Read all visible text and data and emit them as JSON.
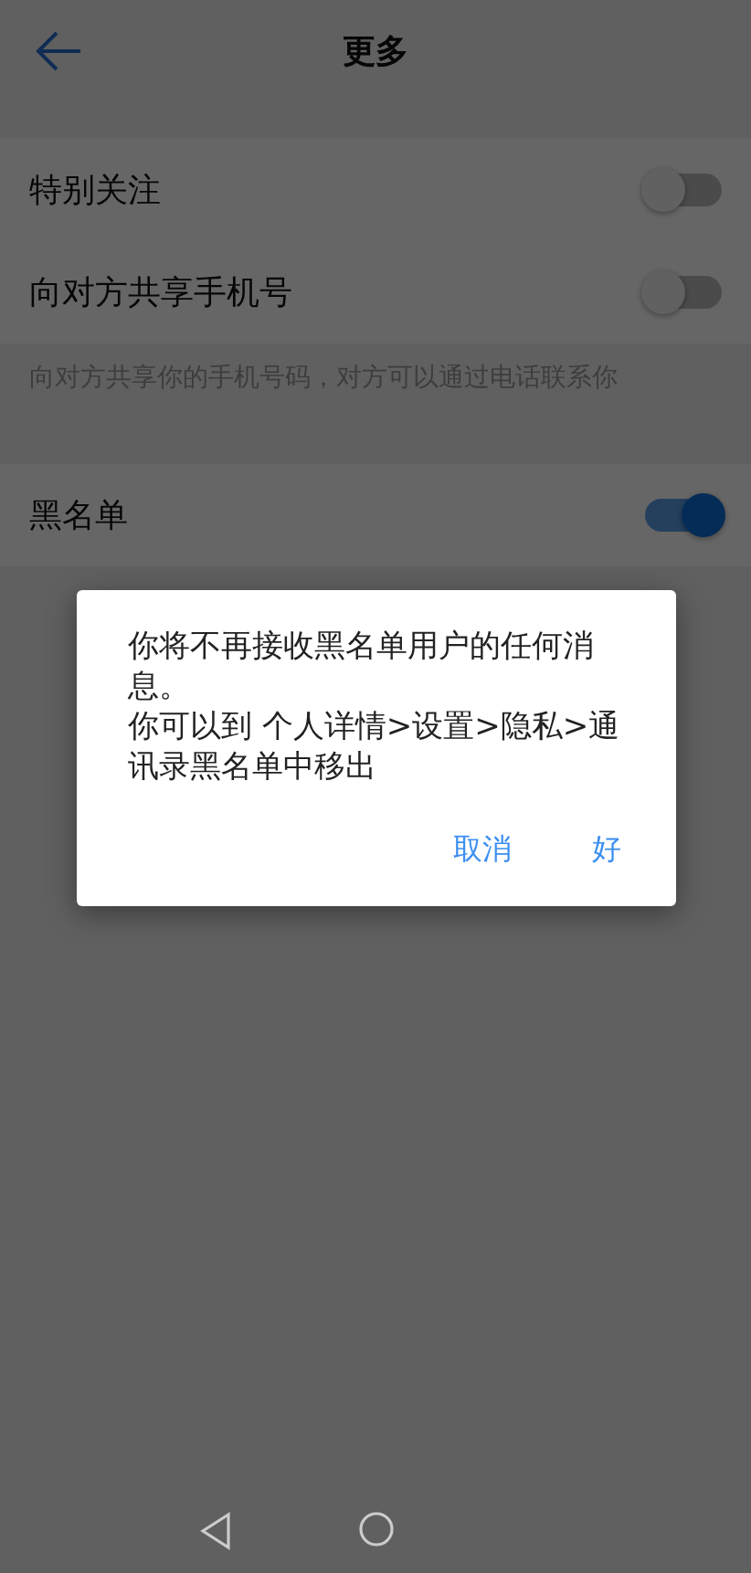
{
  "header": {
    "title": "更多"
  },
  "settings": [
    {
      "label": "特别关注",
      "on": false
    },
    {
      "label": "向对方共享手机号",
      "on": false,
      "hint": "向对方共享你的手机号码，对方可以通过电话联系你"
    },
    {
      "label": "黑名单",
      "on": true
    }
  ],
  "dialog": {
    "message": [
      "你将不再接收黑名单用户的任何消息。",
      "你可以到 个人详情>设置>隐私>通讯录黑名单中移出"
    ],
    "buttons": [
      "取消",
      "好"
    ]
  }
}
